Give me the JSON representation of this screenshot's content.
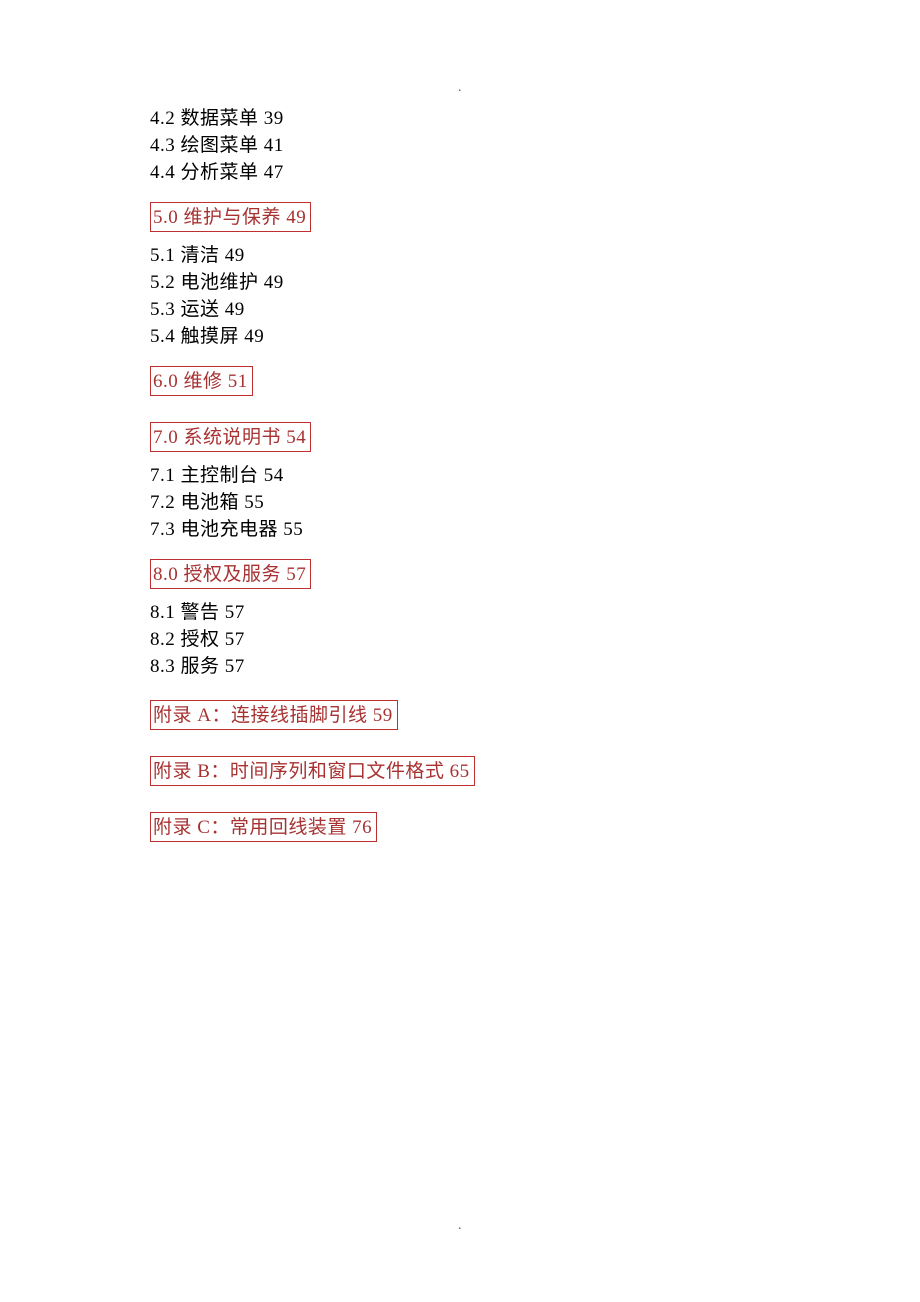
{
  "marker_top": ".",
  "marker_bottom": ".",
  "section4_items": [
    "4.2 数据菜单 39",
    "4.3 绘图菜单 41",
    "4.4 分析菜单 47"
  ],
  "section5": {
    "heading": "5.0 维护与保养 49",
    "items": [
      "5.1 清洁 49",
      "5.2 电池维护 49",
      "5.3 运送 49",
      "5.4 触摸屏 49"
    ]
  },
  "section6": {
    "heading": "6.0 维修 51"
  },
  "section7": {
    "heading": "7.0 系统说明书 54",
    "items": [
      "7.1 主控制台 54",
      "7.2 电池箱 55",
      "7.3 电池充电器 55"
    ]
  },
  "section8": {
    "heading": "8.0 授权及服务 57",
    "items": [
      "8.1 警告 57",
      "8.2 授权 57",
      "8.3 服务 57"
    ]
  },
  "appendixA": "附录 A：连接线插脚引线 59",
  "appendixB": "附录 B：时间序列和窗口文件格式 65",
  "appendixC": "附录 C：常用回线装置 76"
}
